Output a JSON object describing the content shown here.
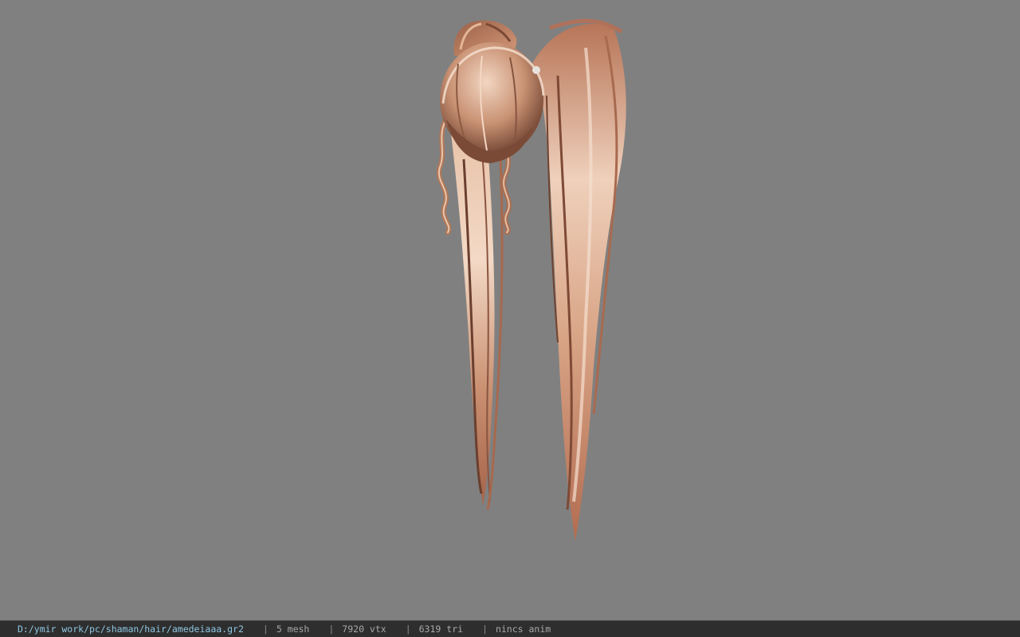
{
  "statusbar": {
    "file_path": "D:/ymir work/pc/shaman/hair/amedeiaaa.gr2",
    "separator": "|",
    "mesh_count": "5 mesh",
    "vertex_count": "7920 vtx",
    "triangle_count": "6319 tri",
    "anim_status": "nincs anim"
  },
  "colors": {
    "viewport_background": "#808080",
    "statusbar_background": "#2e2e2e",
    "path_text": "#8fc7e3",
    "stat_text": "#a8a8a8",
    "hair_dark": "#8a5a44",
    "hair_mid": "#c58d6e",
    "hair_light": "#f0d2bc"
  }
}
